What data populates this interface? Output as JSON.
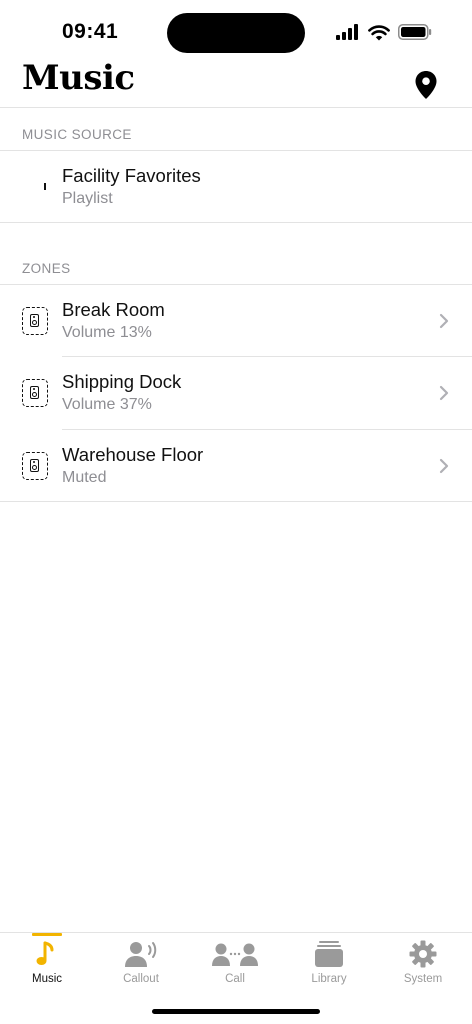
{
  "status_bar": {
    "time": "09:41"
  },
  "header": {
    "title": "Music"
  },
  "music_source": {
    "section_label": "MUSIC SOURCE",
    "title": "Facility Favorites",
    "subtitle": "Playlist"
  },
  "zones": {
    "section_label": "ZONES",
    "items": [
      {
        "name": "Break Room",
        "status": "Volume 13%"
      },
      {
        "name": "Shipping Dock",
        "status": "Volume 37%"
      },
      {
        "name": "Warehouse Floor",
        "status": "Muted"
      }
    ]
  },
  "tab_bar": {
    "accent_color": "#f2b400",
    "tabs": [
      {
        "label": "Music",
        "icon": "music-note-icon",
        "active": true
      },
      {
        "label": "Callout",
        "icon": "callout-icon",
        "active": false
      },
      {
        "label": "Call",
        "icon": "call-icon",
        "active": false
      },
      {
        "label": "Library",
        "icon": "library-icon",
        "active": false
      },
      {
        "label": "System",
        "icon": "gear-icon",
        "active": false
      }
    ]
  }
}
